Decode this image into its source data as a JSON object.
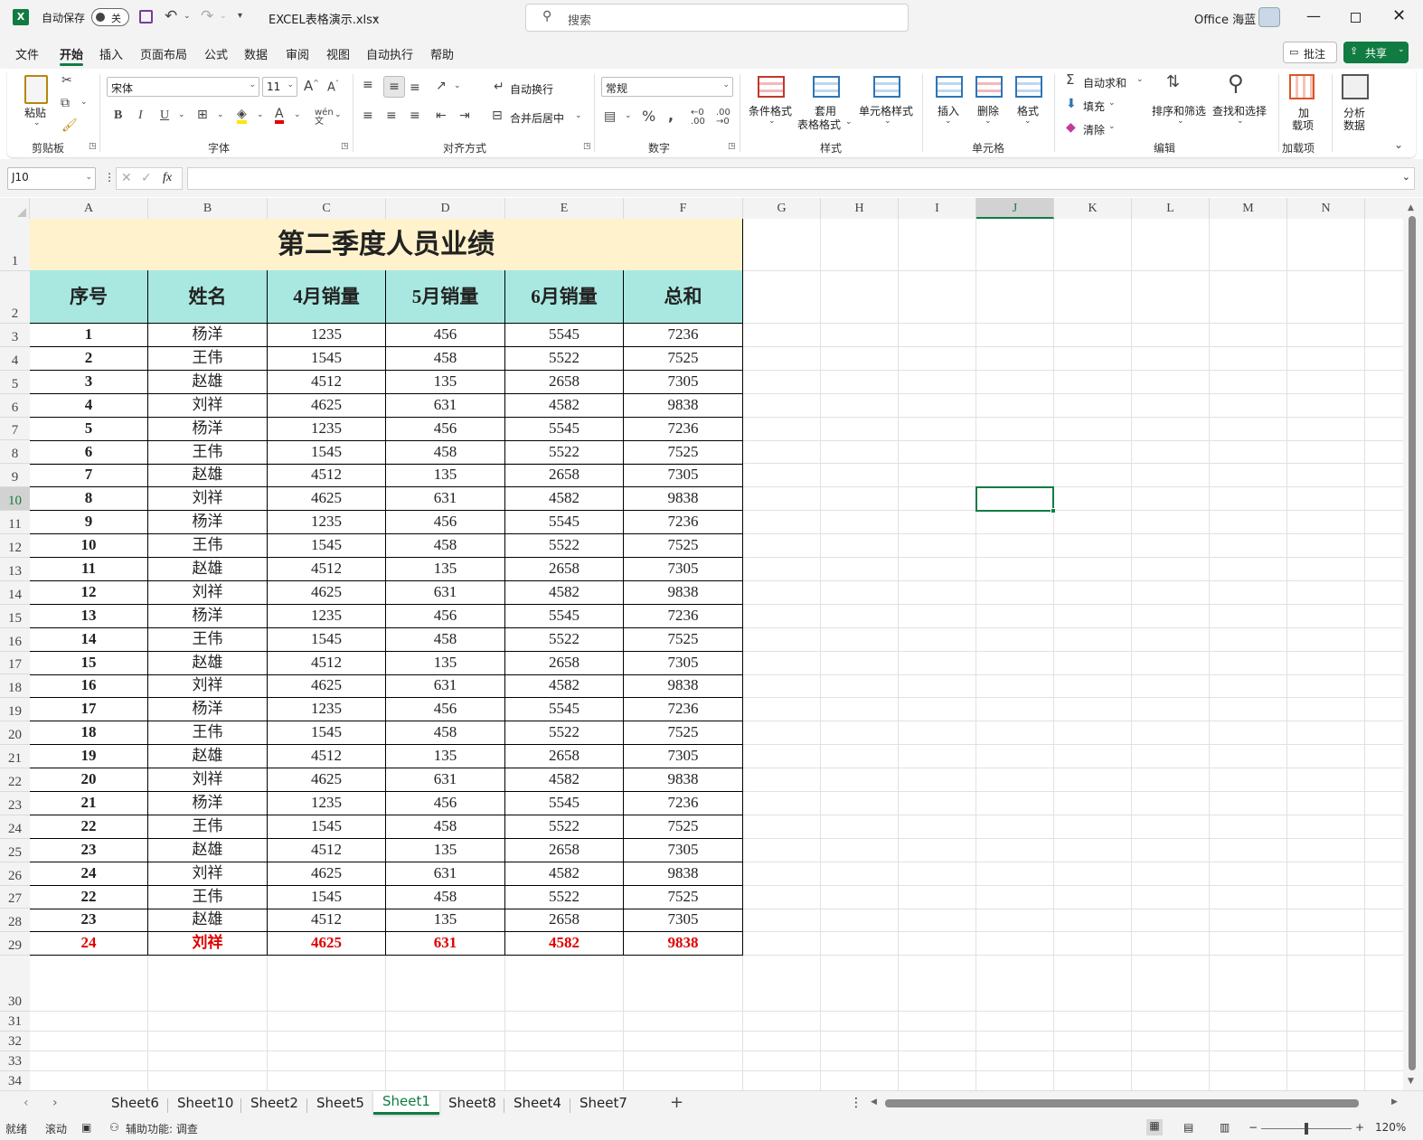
{
  "titlebar": {
    "autosave_label": "自动保存",
    "autosave_state": "关",
    "filename": "EXCEL表格演示.xlsx",
    "search_placeholder": "搜索",
    "user": "Office 海蓝"
  },
  "menu": [
    "文件",
    "开始",
    "插入",
    "页面布局",
    "公式",
    "数据",
    "审阅",
    "视图",
    "自动执行",
    "帮助"
  ],
  "menu_right": {
    "comment": "批注",
    "share": "共享"
  },
  "ribbon": {
    "clipboard": {
      "paste": "粘贴",
      "group": "剪贴板"
    },
    "font": {
      "name": "宋体",
      "size": "11",
      "group": "字体"
    },
    "alignment": {
      "wrap": "自动换行",
      "merge": "合并后居中",
      "group": "对齐方式"
    },
    "number": {
      "format": "常规",
      "group": "数字"
    },
    "styles": {
      "conditional": "条件格式",
      "table1": "套用",
      "table2": "表格格式",
      "cell_styles": "单元格样式",
      "group": "样式"
    },
    "cells": {
      "insert": "插入",
      "delete": "删除",
      "format": "格式",
      "group": "单元格"
    },
    "editing": {
      "autosum": "自动求和",
      "fill": "填充",
      "clear": "清除",
      "sort": "排序和筛选",
      "find": "查找和选择",
      "group": "编辑"
    },
    "addins": {
      "addin1": "加",
      "addin2": "载项",
      "group": "加载项"
    },
    "analysis": {
      "label1": "分析",
      "label2": "数据"
    }
  },
  "formula": {
    "namebox": "J10",
    "fx": "fx",
    "value": ""
  },
  "columns": [
    "A",
    "B",
    "C",
    "D",
    "E",
    "F",
    "G",
    "H",
    "I",
    "J",
    "K",
    "L",
    "M",
    "N"
  ],
  "rows": [
    "1",
    "2",
    "3",
    "4",
    "5",
    "6",
    "7",
    "8",
    "9",
    "10",
    "11",
    "12",
    "13",
    "14",
    "15",
    "16",
    "17",
    "18",
    "19",
    "20",
    "21",
    "22",
    "23",
    "24",
    "25",
    "26",
    "27",
    "28",
    "29",
    "30",
    "31",
    "32",
    "33",
    "34"
  ],
  "sheet": {
    "title": "第二季度人员业绩",
    "headers": [
      "序号",
      "姓名",
      "4月销量",
      "5月销量",
      "6月销量",
      "总和"
    ],
    "data": [
      [
        "1",
        "杨洋",
        "1235",
        "456",
        "5545",
        "7236"
      ],
      [
        "2",
        "王伟",
        "1545",
        "458",
        "5522",
        "7525"
      ],
      [
        "3",
        "赵雄",
        "4512",
        "135",
        "2658",
        "7305"
      ],
      [
        "4",
        "刘祥",
        "4625",
        "631",
        "4582",
        "9838"
      ],
      [
        "5",
        "杨洋",
        "1235",
        "456",
        "5545",
        "7236"
      ],
      [
        "6",
        "王伟",
        "1545",
        "458",
        "5522",
        "7525"
      ],
      [
        "7",
        "赵雄",
        "4512",
        "135",
        "2658",
        "7305"
      ],
      [
        "8",
        "刘祥",
        "4625",
        "631",
        "4582",
        "9838"
      ],
      [
        "9",
        "杨洋",
        "1235",
        "456",
        "5545",
        "7236"
      ],
      [
        "10",
        "王伟",
        "1545",
        "458",
        "5522",
        "7525"
      ],
      [
        "11",
        "赵雄",
        "4512",
        "135",
        "2658",
        "7305"
      ],
      [
        "12",
        "刘祥",
        "4625",
        "631",
        "4582",
        "9838"
      ],
      [
        "13",
        "杨洋",
        "1235",
        "456",
        "5545",
        "7236"
      ],
      [
        "14",
        "王伟",
        "1545",
        "458",
        "5522",
        "7525"
      ],
      [
        "15",
        "赵雄",
        "4512",
        "135",
        "2658",
        "7305"
      ],
      [
        "16",
        "刘祥",
        "4625",
        "631",
        "4582",
        "9838"
      ],
      [
        "17",
        "杨洋",
        "1235",
        "456",
        "5545",
        "7236"
      ],
      [
        "18",
        "王伟",
        "1545",
        "458",
        "5522",
        "7525"
      ],
      [
        "19",
        "赵雄",
        "4512",
        "135",
        "2658",
        "7305"
      ],
      [
        "20",
        "刘祥",
        "4625",
        "631",
        "4582",
        "9838"
      ],
      [
        "21",
        "杨洋",
        "1235",
        "456",
        "5545",
        "7236"
      ],
      [
        "22",
        "王伟",
        "1545",
        "458",
        "5522",
        "7525"
      ],
      [
        "23",
        "赵雄",
        "4512",
        "135",
        "2658",
        "7305"
      ],
      [
        "24",
        "刘祥",
        "4625",
        "631",
        "4582",
        "9838"
      ],
      [
        "22",
        "王伟",
        "1545",
        "458",
        "5522",
        "7525"
      ],
      [
        "23",
        "赵雄",
        "4512",
        "135",
        "2658",
        "7305"
      ],
      [
        "24",
        "刘祥",
        "4625",
        "631",
        "4582",
        "9838"
      ]
    ],
    "highlight_color": "#e00000"
  },
  "tabs": [
    "Sheet6",
    "Sheet10",
    "Sheet2",
    "Sheet5",
    "Sheet1",
    "Sheet8",
    "Sheet4",
    "Sheet7"
  ],
  "active_tab": "Sheet1",
  "status": {
    "ready": "就绪",
    "scroll": "滚动",
    "accessibility": "辅助功能: 调查",
    "zoom": "120%"
  },
  "accent": "#107c41"
}
